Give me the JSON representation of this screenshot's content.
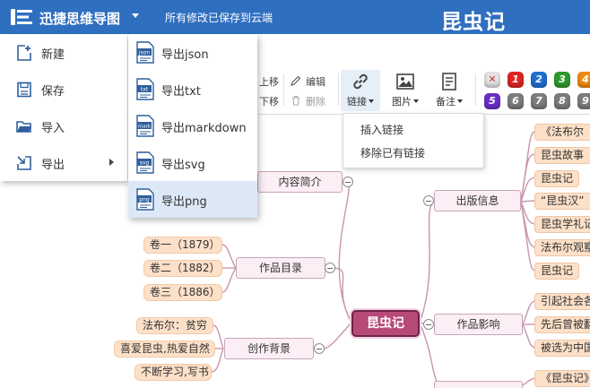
{
  "header": {
    "app_title": "迅捷思维导图",
    "save_status": "所有修改已保存到云端",
    "doc_title": "昆虫记"
  },
  "main_menu": {
    "items": [
      {
        "label": "新建",
        "icon": "new-file-icon"
      },
      {
        "label": "保存",
        "icon": "save-icon"
      },
      {
        "label": "导入",
        "icon": "folder-open-icon"
      },
      {
        "label": "导出",
        "icon": "export-icon"
      }
    ]
  },
  "export_menu": {
    "items": [
      {
        "label": "导出json",
        "badge": "json"
      },
      {
        "label": "导出txt",
        "badge": "txt"
      },
      {
        "label": "导出markdown",
        "badge": "mark"
      },
      {
        "label": "导出svg",
        "badge": "svg"
      },
      {
        "label": "导出png",
        "badge": "png",
        "active": true
      }
    ]
  },
  "toolbar": {
    "move_up_partial": "上移",
    "move_down_partial": "下移",
    "edit": "编辑",
    "delete": "删除",
    "link": "链接",
    "image": "图片",
    "note": "备注",
    "priority_row1": [
      "✕",
      "1",
      "2",
      "3",
      "4"
    ],
    "priority_row2": [
      "5",
      "6",
      "7",
      "8",
      "9"
    ],
    "priority_colors": {
      "clear": "#e0e0e0",
      "p1": "#e02424",
      "p2": "#1f6fd0",
      "p3": "#2f9a2f",
      "p4": "#f08a12",
      "p5": "#6a2fc7",
      "p6_plus": "#7d7d7d"
    }
  },
  "link_dropdown": {
    "items": [
      "插入链接",
      "移除已有链接"
    ]
  },
  "mindmap": {
    "root": "昆虫记",
    "topics": {
      "intro": "内容简介",
      "works": "作品目录",
      "background": "创作背景",
      "publish": "出版信息",
      "impact": "作品影响"
    },
    "works_leaves": [
      "卷一（1879）",
      "卷二（1882）",
      "卷三（1886）"
    ],
    "background_leaves": [
      "法布尔：贫穷",
      "喜爱昆虫,热爱自然",
      "不断学习,写书"
    ],
    "publish_leaves": [
      "《法布尔",
      "昆虫故事",
      "昆虫记",
      "“昆虫汉”",
      "昆虫学礼记",
      "法布尔观察",
      "昆虫记"
    ],
    "impact_leaves": [
      "引起社会各",
      "先后曾被翻",
      "被选为中国"
    ],
    "bottom_leaf": "《昆虫记》"
  },
  "colors": {
    "header_bg": "#2f6fc0",
    "root_fill": "#b84a7a",
    "topic_fill": "#fbeef4",
    "leaf_fill": "#fde0c8",
    "branch_line": "#c996ad"
  }
}
